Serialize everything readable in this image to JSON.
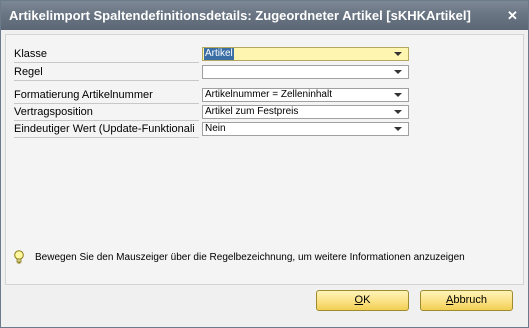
{
  "window": {
    "title": "Artikelimport Spaltendefinitionsdetails: Zugeordneter Artikel [sKHKArtikel]",
    "close_glyph": "✕"
  },
  "form": {
    "fields": [
      {
        "label": "Klasse",
        "value": "Artikel"
      },
      {
        "label": "Regel",
        "value": ""
      },
      {
        "label": "Formatierung Artikelnummer",
        "value": "Artikelnummer = Zelleninhalt"
      },
      {
        "label": "Vertragsposition",
        "value": "Artikel zum Festpreis"
      },
      {
        "label": "Eindeutiger Wert (Update-Funktionalitä",
        "value": "Nein"
      }
    ]
  },
  "hint": {
    "icon": "lightbulb-icon",
    "text": "Bewegen Sie den Mauszeiger über die Regelbezeichnung, um weitere Informationen anzuzeigen"
  },
  "buttons": {
    "ok": {
      "mnemonic": "O",
      "rest": "K"
    },
    "cancel": {
      "mnemonic": "A",
      "rest": "bbruch"
    }
  },
  "colors": {
    "titlebar": "#6a7583",
    "button_face": "#fbe38a",
    "active_field": "#fdf5b0",
    "selection": "#3a6ea5"
  }
}
